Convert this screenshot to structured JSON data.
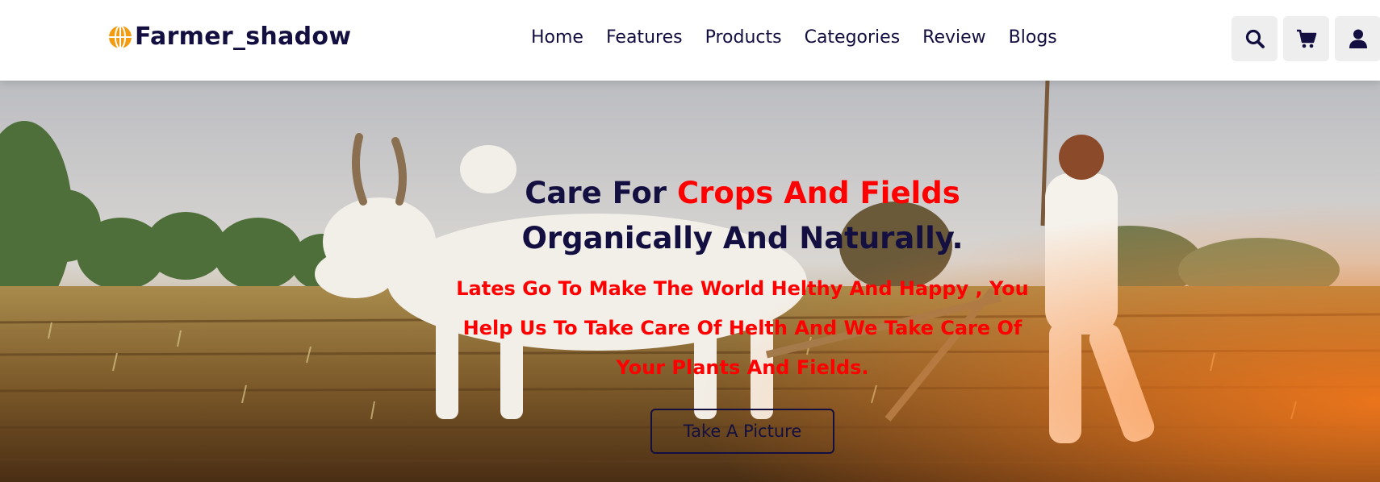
{
  "header": {
    "logo_text": "Farmer_shadow",
    "logo_icon": "globe-icon",
    "nav": [
      {
        "label": "Home"
      },
      {
        "label": "Features"
      },
      {
        "label": "Products"
      },
      {
        "label": "Categories"
      },
      {
        "label": "Review"
      },
      {
        "label": "Blogs"
      }
    ],
    "icons": [
      "search-icon",
      "cart-icon",
      "user-icon"
    ]
  },
  "hero": {
    "title_part1": "Care For ",
    "title_highlight": "Crops And Fields",
    "title_part2": " Organically And Naturally.",
    "description": "Lates Go To Make The World Helthy And Happy , You Help Us To Take Care Of Helth And We Take Care Of Your Plants And Fields.",
    "button_label": "Take A Picture"
  },
  "colors": {
    "brand_dark": "#130f40",
    "accent_red": "#ff0000",
    "logo_orange": "#f39c12"
  }
}
